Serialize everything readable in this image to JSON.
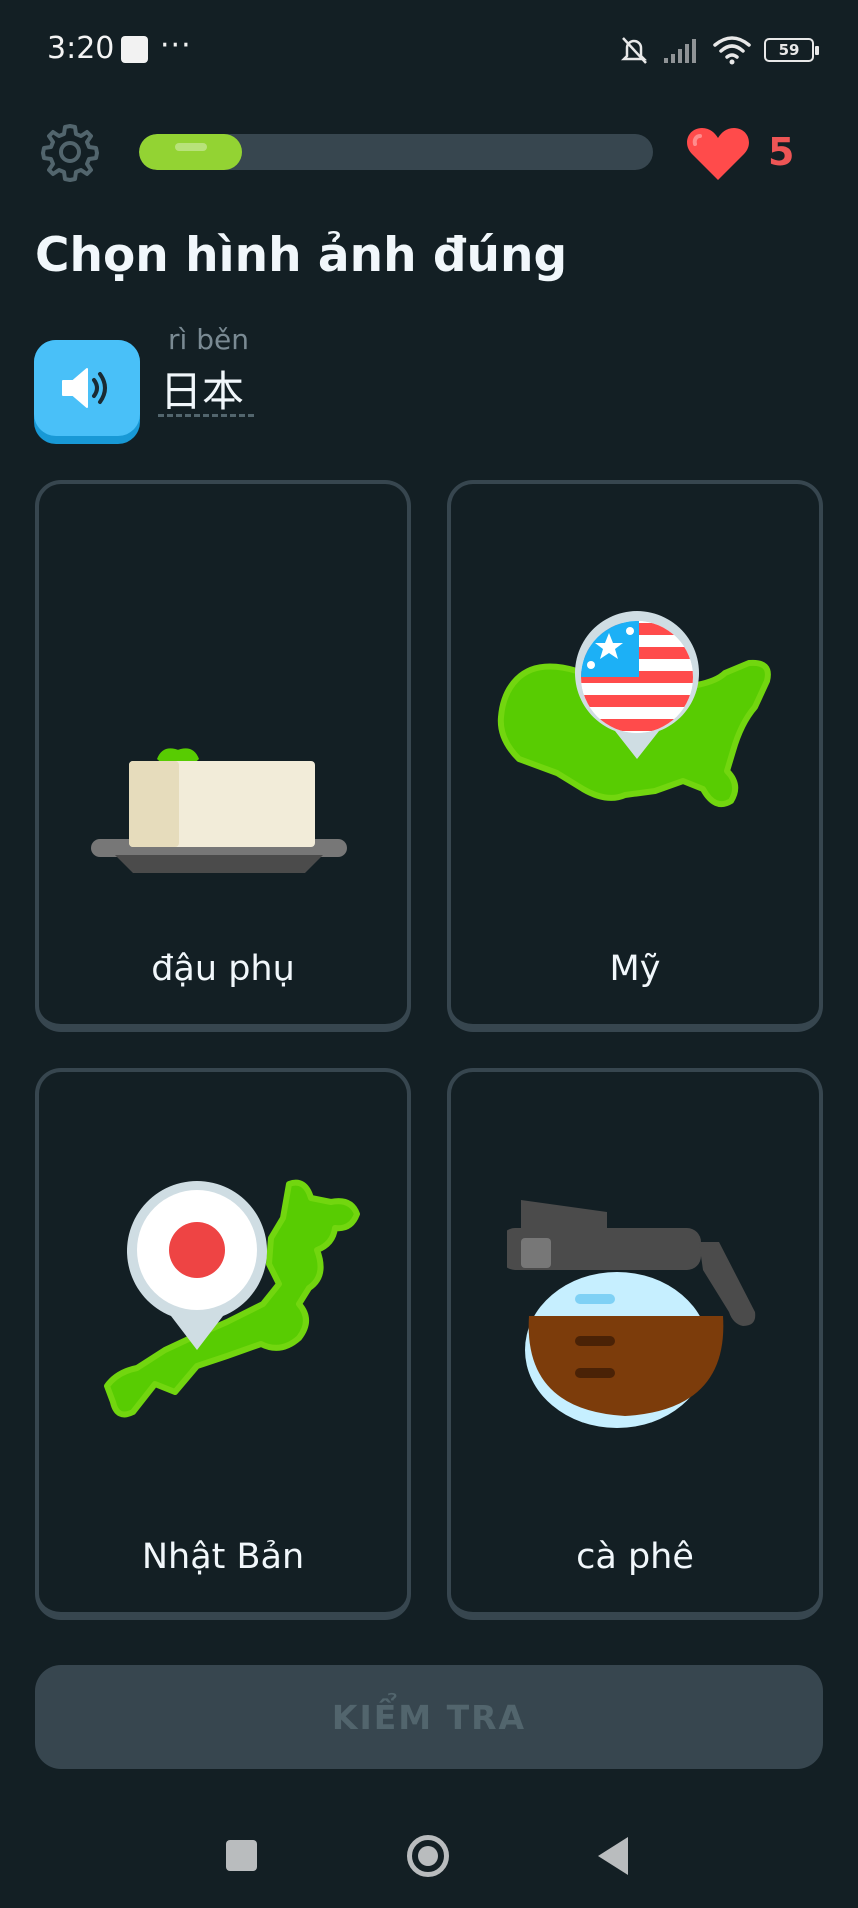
{
  "status_bar": {
    "time": "3:20",
    "more": "···",
    "battery": "59",
    "icons": [
      "notification-square-icon",
      "bell-off-icon",
      "signal-icon",
      "wifi-icon",
      "battery-icon"
    ]
  },
  "header": {
    "progress": 0.2,
    "hearts": "5",
    "icons": [
      "gear-icon",
      "heart-icon"
    ]
  },
  "prompt": {
    "title": "Chọn hình ảnh đúng",
    "pinyin": "rì běn",
    "word": "日本",
    "speaker_icon": "speaker-icon"
  },
  "choices": [
    {
      "label": "đậu phụ",
      "icon": "tofu-icon"
    },
    {
      "label": "Mỹ",
      "icon": "usa-map-icon"
    },
    {
      "label": "Nhật Bản",
      "icon": "japan-map-icon"
    },
    {
      "label": "cà phê",
      "icon": "coffee-pot-icon"
    }
  ],
  "footer": {
    "check_label": "KIỂM TRA"
  },
  "colors": {
    "background": "#131f24",
    "border": "#37464f",
    "progress": "#93d333",
    "heart": "#ee5555",
    "speaker": "#49c0f8"
  }
}
